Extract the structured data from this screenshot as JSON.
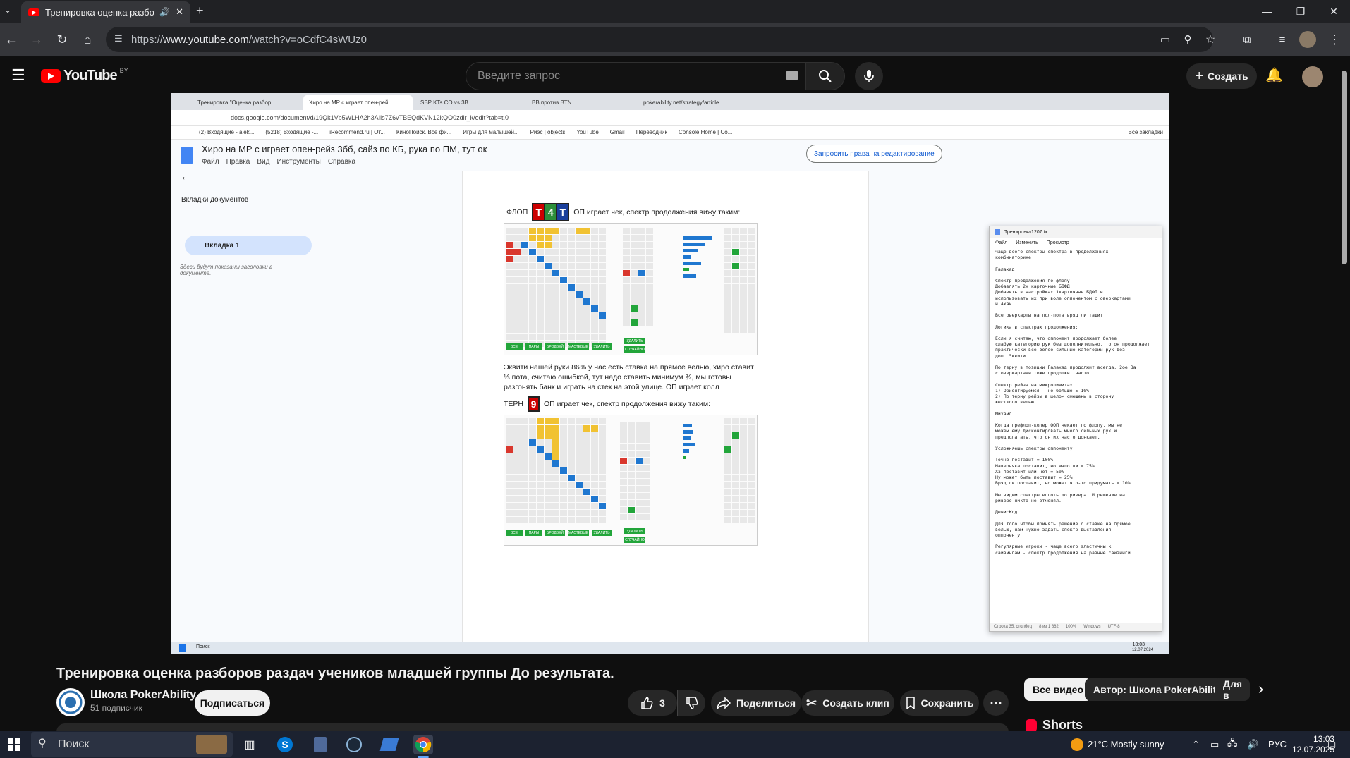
{
  "browser": {
    "tab_title": "Тренировка оценка разбо",
    "url_prefix": "https://",
    "url_domain": "www.youtube.com",
    "url_path": "/watch?v=oCdfC4sWUz0"
  },
  "youtube": {
    "logo_text": "YouTube",
    "region": "BY",
    "search_placeholder": "Введите запрос",
    "create_label": "Создать"
  },
  "video_frame": {
    "tabs": [
      "Тренировка \"Оценка разбор",
      "Хиро на МР с играет опен-рей",
      "SBP KTs CO vs 3B",
      "BB против BTN",
      "pokerability.net/strategy/article"
    ],
    "url": "docs.google.com/document/d/19Qk1Vb5WLHA2h3AIls7Z6vTBEQdKVN12kQO0zdlr_k/edit?tab=t.0",
    "bookmarks": [
      "(2) Входящие - alek...",
      "(5218) Входящие -...",
      "iRecommend.ru | От...",
      "КиноПоиск. Все фи...",
      "Игры для малышей...",
      "Риэс | objects",
      "YouTube",
      "Gmail",
      "Переводчик",
      "Console Home | Co...",
      "Все закладки"
    ],
    "doc_title": "Хиро на МР с  играет опен-рейз 3бб, сайз по КБ, рука по ПМ, тут ок",
    "doc_menu": [
      "Файл",
      "Правка",
      "Вид",
      "Инструменты",
      "Справка"
    ],
    "request_button": "Запросить права на редактирование",
    "sidebar_heading": "Вкладки документов",
    "sidebar_tab": "Вкладка 1",
    "sidebar_note": "Здесь будут показаны заголовки в документе.",
    "flop_label": "ФЛОП",
    "flop_cards": [
      "T",
      "4",
      "T"
    ],
    "flop_text": "ОП играет  чек, спектр продолжения вижу таким:",
    "paragraph": "Эквити нашей руки 86% у нас есть ставка на прямое велью, хиро ставит ⅓ пота, считаю ошибкой, тут надо ставить минимум ¾, мы готовы разгонять банк и играть на стек на этой улице. ОП играет колл",
    "turn_label": "ТЕРН",
    "turn_card": "9",
    "turn_text": "ОП играет чек, спектр продолжения вижу таким:",
    "grid_buttons": [
      "ВСЕ",
      "ПАРЫ",
      "БРОДВЕЙ",
      "МАСТЕВЫЕ",
      "УДАЛИТЬ"
    ],
    "side_buttons": [
      "УДАЛИТЬ",
      "СЛУЧАЙНО"
    ],
    "notepad": {
      "title": "Тренировка1207.tx",
      "menu": [
        "Файл",
        "Изменить",
        "Просмотр"
      ],
      "text": "чаще всего спектры спектра в продолжениях\nкомбинаторике\n\nГалахад\n\nСпектр продолжения по флопу -\nДобавлять 2х карточные БДФД\nДобавить в настройках 1карточные БДФД и\nиспользовать их при воле оппонентом с оверкартами\nи Ахай\n\nВсе оверкарты на пол-пота вряд ли тащит\n\nЛогика в спектрах продолжения:\n\nЕсли я считаю, что оппонент продолжает более\nслабую категорию рук без дополнительно, то он продолжает\nпрактически все более сильные категории рук без\nдоп. Эквити\n\nПо терну в позиции Галахад продолжит всегда, 2ое Ва\nс оверкартами тоже продолжит часто\n\nСпектр рейза на микролимитах:\n1) Ориентируемся - не больше 5-10%\n2) По терну рейзы в целом смещены в сторону\nжесткого велью\n\nМихаил.\n\nКогда префлоп-колер ООП чекает по флопу, мы не\nможем ему дисконтировать много сильных рук и\nпредполагать, что он их часто донкает.\n\nУсложняешь спектры оппоненту\n\nТочно поставит = 100%\nНаверняка поставит, но мало ли = 75%\nХз поставит или нет = 50%\nНу может быть поставит = 25%\nВряд ли поставит, но может что-то придумать = 10%\n\nМы видим спектры вплоть до ривера. И решение на\nривере никто не отменял.\n\nДенисКод\n\nДля того чтобы принять решение о ставке на прямое\nвелью, нам нужно задать спектр выставления\nоппоненту\n\nРегулярные игроки - чаще всего эластичны к\nсайзингам - спектр продолжения на разные сайзинги",
      "status": [
        "Строка 35, столбец",
        "8 из 1 862",
        "100%",
        "Windows",
        "UTF-8"
      ]
    },
    "taskbar_search": "Поиск",
    "time_small": "13:03",
    "date_small": "12.07.2024"
  },
  "video_info": {
    "title": "Тренировка оценка разборов раздач учеников младшей группы До результата.",
    "channel_name": "Школа PokerAbility",
    "subscribers": "51 подписчик",
    "subscribe_label": "Подписаться",
    "likes": "3",
    "share_label": "Поделиться",
    "clip_label": "Создать клип",
    "save_label": "Сохранить"
  },
  "chips": [
    "Все видео",
    "Автор: Школа PokerAbility",
    "Для в"
  ],
  "shorts_label": "Shorts",
  "taskbar": {
    "search_label": "Поиск",
    "weather": "21°C  Mostly sunny",
    "lang": "РУС",
    "time": "13:03",
    "date": "12.07.2025"
  }
}
